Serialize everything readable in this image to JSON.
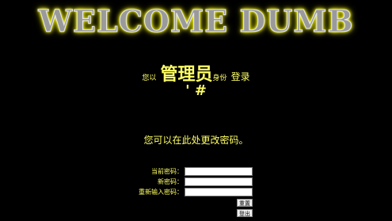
{
  "banner": {
    "title": "WELCOME DUMB"
  },
  "login": {
    "prefix": "您以",
    "role": "管理员",
    "identity": "身份",
    "action": "登录"
  },
  "marker": "' #",
  "note": "您可以在此处更改密码。",
  "form": {
    "current_password_label": "当前密码：",
    "new_password_label": "新密码：",
    "confirm_password_label": "重新输入密码：",
    "current_password_value": "",
    "new_password_value": "",
    "confirm_password_value": "",
    "reset_label": "重置",
    "logout_label": "登出"
  },
  "colors": {
    "background": "#000000",
    "text": "#ffff66",
    "banner_glow": "#ffff00"
  }
}
